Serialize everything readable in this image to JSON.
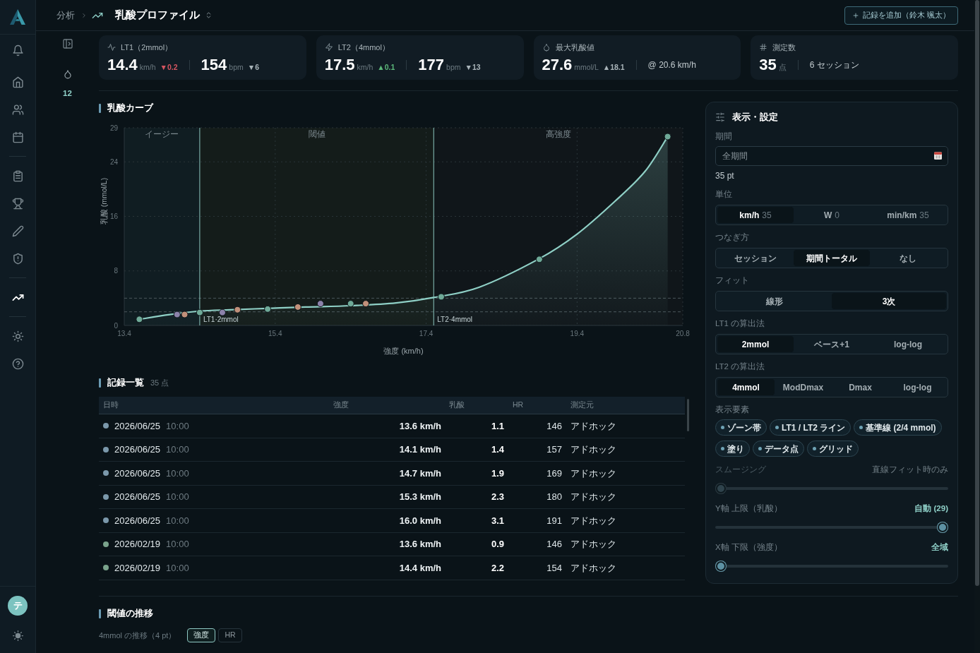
{
  "sidebar": {
    "groups": [
      {
        "items": [
          {
            "selected": false
          },
          {
            "selected": false
          },
          {
            "selected": false
          }
        ]
      },
      {
        "items": [
          {
            "selected": false
          },
          {
            "selected": false
          },
          {
            "selected": false
          },
          {
            "selected": false
          }
        ]
      },
      {
        "items": [
          {
            "selected": true
          }
        ]
      },
      {
        "items": [
          {
            "selected": false
          },
          {
            "selected": false
          }
        ]
      }
    ],
    "avatar": "テ"
  },
  "header": {
    "breadcrumb": "分析",
    "title": "乳酸プロファイル",
    "add_button": "記録を追加（鈴木 颯太）"
  },
  "side_panel": {
    "count": "12"
  },
  "stats": [
    {
      "label": "LT1（2mmol）",
      "primary": {
        "value": "14.4",
        "unit": "km/h",
        "delta": {
          "text": "▼0.2",
          "color": "#d45560"
        }
      },
      "secondary": {
        "kind": "metric",
        "value": "154",
        "unit": "bpm",
        "delta": {
          "text": "▼6",
          "color": "#a9b4b9"
        }
      }
    },
    {
      "label": "LT2（4mmol）",
      "primary": {
        "value": "17.5",
        "unit": "km/h",
        "delta": {
          "text": "▲0.1",
          "color": "#5cb87a"
        }
      },
      "secondary": {
        "kind": "metric",
        "value": "177",
        "unit": "bpm",
        "delta": {
          "text": "▼13",
          "color": "#a9b4b9"
        }
      }
    },
    {
      "label": "最大乳酸値",
      "primary": {
        "value": "27.6",
        "unit": "mmol/L",
        "delta": {
          "text": "▲18.1",
          "color": "#a9b4b9"
        }
      },
      "secondary": {
        "kind": "note",
        "text": "@ 20.6 km/h"
      }
    },
    {
      "label": "測定数",
      "primary": {
        "value": "35",
        "unit": "点"
      },
      "secondary": {
        "kind": "note",
        "text": "6 セッション"
      }
    }
  ],
  "chart": {
    "title": "乳酸カーブ",
    "chart_data": {
      "type": "scatter",
      "xlabel": "強度 (km/h)",
      "ylabel": "乳酸 (mmol/L)",
      "xlim": [
        13.4,
        20.8
      ],
      "ylim": [
        0,
        29
      ],
      "xticks": [
        13.4,
        15.4,
        17.4,
        19.4,
        20.8
      ],
      "yticks": [
        0,
        8,
        16,
        24,
        29
      ],
      "grid": true,
      "series": [
        {
          "type": "area",
          "color": "#8fd0c6",
          "x": [
            13.6,
            14.0,
            14.4,
            14.8,
            15.3,
            15.8,
            16.4,
            17.0,
            17.5,
            18.1,
            18.9,
            19.4,
            19.9,
            20.3,
            20.6
          ],
          "values": [
            0.9,
            1.6,
            2.1,
            2.3,
            2.5,
            2.7,
            2.9,
            3.3,
            4.1,
            5.6,
            9.8,
            13.4,
            18.2,
            22.6,
            27.7
          ]
        },
        {
          "color": "#6faa98",
          "x": [
            13.6,
            14.4,
            15.3,
            16.4,
            17.6,
            18.9,
            20.6
          ],
          "values": [
            0.9,
            1.9,
            2.4,
            3.2,
            4.2,
            9.7,
            27.7
          ]
        },
        {
          "color": "#8c82aa",
          "x": [
            14.1,
            14.7,
            16.0
          ],
          "values": [
            1.6,
            1.9,
            3.2
          ]
        },
        {
          "color": "#c1907a",
          "x": [
            14.2,
            14.9,
            15.7,
            16.6
          ],
          "values": [
            1.6,
            2.3,
            2.7,
            3.2
          ]
        }
      ],
      "bands": [
        {
          "axis": "x",
          "from": 13.4,
          "to": 14.4,
          "label": "イージー",
          "color": "#101d22"
        },
        {
          "axis": "x",
          "from": 14.4,
          "to": 17.5,
          "label": "閾値",
          "color": "#141c1a"
        },
        {
          "axis": "x",
          "from": 17.5,
          "to": 20.8,
          "label": "高強度",
          "color": "#10161a"
        }
      ],
      "ref_lines": [
        {
          "axis": "y",
          "value": 2
        },
        {
          "axis": "y",
          "value": 4
        },
        {
          "axis": "x",
          "value": 14.4,
          "label": "LT1·2mmol"
        },
        {
          "axis": "x",
          "value": 17.5,
          "label": "LT2·4mmol"
        }
      ]
    }
  },
  "records": {
    "title": "記録一覧",
    "count": "35 点",
    "columns": [
      "日時",
      "強度",
      "乳酸",
      "HR",
      "測定元"
    ],
    "rows": [
      {
        "date": "2026/06/25",
        "time": "10:00",
        "intensity": "13.6 km/h",
        "lactate": "1.1",
        "hr": "146",
        "source": "アドホック",
        "color": "#7b98ab"
      },
      {
        "date": "2026/06/25",
        "time": "10:00",
        "intensity": "14.1 km/h",
        "lactate": "1.4",
        "hr": "157",
        "source": "アドホック",
        "color": "#7b98ab"
      },
      {
        "date": "2026/06/25",
        "time": "10:00",
        "intensity": "14.7 km/h",
        "lactate": "1.9",
        "hr": "169",
        "source": "アドホック",
        "color": "#7b98ab"
      },
      {
        "date": "2026/06/25",
        "time": "10:00",
        "intensity": "15.3 km/h",
        "lactate": "2.3",
        "hr": "180",
        "source": "アドホック",
        "color": "#7b98ab"
      },
      {
        "date": "2026/06/25",
        "time": "10:00",
        "intensity": "16.0 km/h",
        "lactate": "3.1",
        "hr": "191",
        "source": "アドホック",
        "color": "#7b98ab"
      },
      {
        "date": "2026/02/19",
        "time": "10:00",
        "intensity": "13.6 km/h",
        "lactate": "0.9",
        "hr": "146",
        "source": "アドホック",
        "color": "#7aa38c"
      },
      {
        "date": "2026/02/19",
        "time": "10:00",
        "intensity": "14.4 km/h",
        "lactate": "2.2",
        "hr": "154",
        "source": "アドホック",
        "color": "#7aa38c"
      }
    ]
  },
  "settings": {
    "title": "表示・設定",
    "period": {
      "label": "期間",
      "value": "全期間",
      "count": "35 pt"
    },
    "segments": [
      {
        "label": "単位",
        "options": [
          {
            "label": "km/h",
            "count": "35",
            "selected": true
          },
          {
            "label": "W",
            "count": "0",
            "selected": false
          },
          {
            "label": "min/km",
            "count": "35",
            "selected": false
          }
        ]
      },
      {
        "label": "つなぎ方",
        "options": [
          {
            "label": "セッション",
            "selected": false
          },
          {
            "label": "期間トータル",
            "selected": true
          },
          {
            "label": "なし",
            "selected": false
          }
        ]
      },
      {
        "label": "フィット",
        "options": [
          {
            "label": "線形",
            "selected": false
          },
          {
            "label": "3次",
            "selected": true
          }
        ]
      },
      {
        "label": "LT1 の算出法",
        "options": [
          {
            "label": "2mmol",
            "selected": true
          },
          {
            "label": "ベース+1",
            "selected": false
          },
          {
            "label": "log-log",
            "selected": false
          }
        ]
      },
      {
        "label": "LT2 の算出法",
        "options": [
          {
            "label": "4mmol",
            "selected": true
          },
          {
            "label": "ModDmax",
            "selected": false
          },
          {
            "label": "Dmax",
            "selected": false
          },
          {
            "label": "log-log",
            "selected": false
          }
        ]
      }
    ],
    "display": {
      "label": "表示要素",
      "chips": [
        {
          "label": "ゾーン帯",
          "on": true
        },
        {
          "label": "LT1 / LT2 ライン",
          "on": true
        },
        {
          "label": "基準線 (2/4 mmol)",
          "on": true
        },
        {
          "label": "塗り",
          "on": true
        },
        {
          "label": "データ点",
          "on": true
        },
        {
          "label": "グリッド",
          "on": true
        }
      ]
    },
    "sliders": [
      {
        "label": "スムージング",
        "value": "直線フィット時のみ",
        "disabled": true,
        "level": 0
      },
      {
        "label": "Y軸 上限（乳酸）",
        "value": "自動 (29)",
        "disabled": false,
        "level": 1
      },
      {
        "label": "X軸 下限（強度）",
        "value": "全域",
        "disabled": false,
        "level": 0
      }
    ]
  },
  "thresholds": {
    "title": "閾値の推移",
    "subtitle": "4mmol の推移（4 pt）",
    "toggles": [
      {
        "label": "強度",
        "selected": true
      },
      {
        "label": "HR",
        "selected": false
      }
    ]
  }
}
